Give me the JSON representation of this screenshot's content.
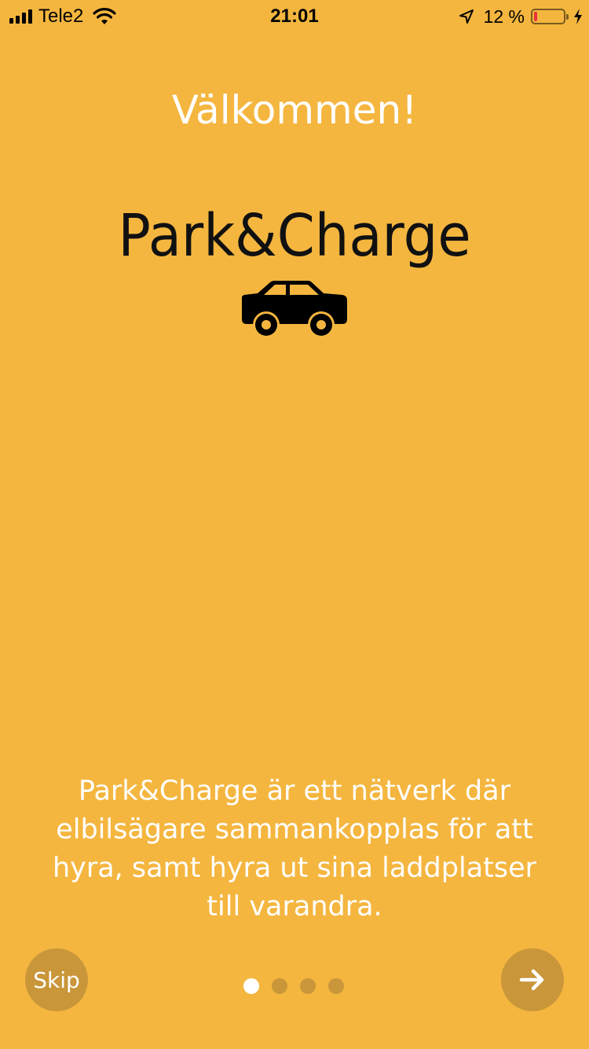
{
  "status_bar": {
    "carrier": "Tele2",
    "time": "21:01",
    "battery_percent": "12 %",
    "battery_level": 0.12,
    "signal_bars": 4,
    "icons": [
      "signal-icon",
      "wifi-icon",
      "location-arrow-icon",
      "battery-icon",
      "charging-bolt-icon"
    ]
  },
  "onboarding": {
    "title": "Välkommen!",
    "logo_text": "Park&Charge",
    "logo_icon": "car-icon",
    "description": "Park&Charge är ett nätverk där elbilsägare sammankopplas för att hyra, samt hyra ut sina laddplatser till varandra.",
    "skip_label": "Skip",
    "next_icon": "arrow-right-icon",
    "page_count": 4,
    "active_page": 1
  },
  "colors": {
    "background": "#F4B63F",
    "button": "#C9963A",
    "text_light": "#FFFFFF",
    "text_dark": "#111111",
    "battery_low": "#E8303A"
  }
}
